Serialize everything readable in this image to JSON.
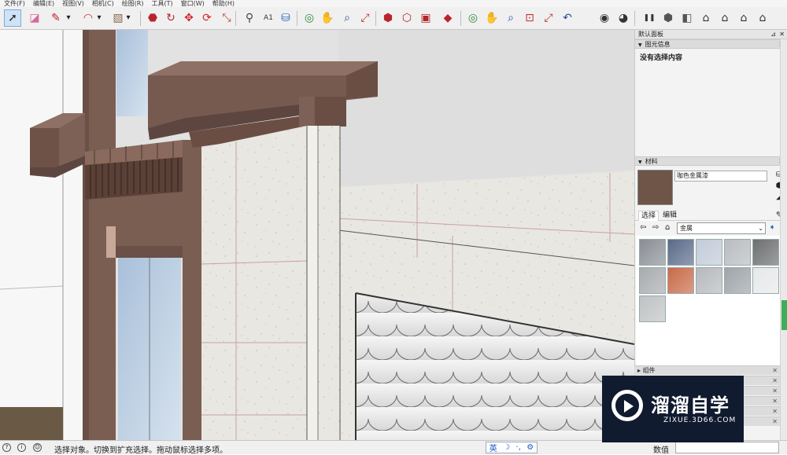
{
  "menu": [
    "文件(F)",
    "编辑(E)",
    "视图(V)",
    "相机(C)",
    "绘图(R)",
    "工具(T)",
    "窗口(W)",
    "帮助(H)"
  ],
  "toolbar": {
    "tools": [
      {
        "name": "select-tool",
        "glyph": "➚",
        "color": "#222222",
        "active": true
      },
      {
        "name": "eraser-tool",
        "glyph": "◪",
        "color": "#d86a9a"
      },
      {
        "name": "line-tool",
        "glyph": "✎",
        "color": "#b8242b"
      },
      {
        "name": "line-dropdown",
        "glyph": "▾",
        "color": "#222222"
      },
      {
        "name": "arc-tool",
        "glyph": "◠",
        "color": "#c0302b"
      },
      {
        "name": "arc-dropdown",
        "glyph": "▾",
        "color": "#222222"
      },
      {
        "name": "rectangle-tool",
        "glyph": "▧",
        "color": "#8a6a4a"
      },
      {
        "name": "rectangle-dropdown",
        "glyph": "▾",
        "color": "#222222"
      },
      {
        "name": "push-pull-tool",
        "glyph": "⬣",
        "color": "#b8242b"
      },
      {
        "name": "follow-me-tool",
        "glyph": "↻",
        "color": "#b8242b"
      },
      {
        "name": "move-tool",
        "glyph": "✥",
        "color": "#d2232a"
      },
      {
        "name": "rotate-tool",
        "glyph": "⟳",
        "color": "#d2232a"
      },
      {
        "name": "scale-tool",
        "glyph": "⤡",
        "color": "#c04020"
      },
      {
        "name": "tape-measure-tool",
        "glyph": "⚲",
        "color": "#444444"
      },
      {
        "name": "text-tool",
        "glyph": "A1",
        "color": "#333333"
      },
      {
        "name": "paint-bucket-tool",
        "glyph": "⛁",
        "color": "#2a6ab8"
      },
      {
        "name": "orbit-tool",
        "glyph": "◎",
        "color": "#2a8a3a"
      },
      {
        "name": "pan-tool",
        "glyph": "✋",
        "color": "#c8a060"
      },
      {
        "name": "zoom-tool",
        "glyph": "⌕",
        "color": "#2a4a9a"
      },
      {
        "name": "zoom-extents-tool",
        "glyph": "⤢",
        "color": "#c0302b"
      },
      {
        "name": "warehouse-tool",
        "glyph": "⬢",
        "color": "#b8242b"
      },
      {
        "name": "share-model-tool",
        "glyph": "⬡",
        "color": "#b8242b"
      },
      {
        "name": "send-to-layout-tool",
        "glyph": "▣",
        "color": "#b8242b"
      },
      {
        "name": "extension-warehouse-tool",
        "glyph": "◆",
        "color": "#b8242b"
      },
      {
        "name": "orbit-tool-2",
        "glyph": "◎",
        "color": "#2a8a3a"
      },
      {
        "name": "pan-tool-2",
        "glyph": "✋",
        "color": "#c8a060"
      },
      {
        "name": "zoom-tool-2",
        "glyph": "⌕",
        "color": "#2a4a9a"
      },
      {
        "name": "zoom-window-tool",
        "glyph": "⊡",
        "color": "#c0302b"
      },
      {
        "name": "zoom-extents-tool-2",
        "glyph": "⤢",
        "color": "#c0302b"
      },
      {
        "name": "previous-view-tool",
        "glyph": "↶",
        "color": "#2a4a9a"
      },
      {
        "name": "position-camera-tool",
        "glyph": "◉",
        "color": "#333333"
      },
      {
        "name": "look-around-tool",
        "glyph": "◕",
        "color": "#333333"
      },
      {
        "name": "walk-tool",
        "glyph": "❚❚",
        "color": "#333333"
      },
      {
        "name": "iso-view",
        "glyph": "⬢",
        "color": "#555555"
      },
      {
        "name": "top-view",
        "glyph": "◧",
        "color": "#555555"
      },
      {
        "name": "front-view",
        "glyph": "⌂",
        "color": "#333333"
      },
      {
        "name": "right-view",
        "glyph": "⌂",
        "color": "#333333"
      },
      {
        "name": "back-view",
        "glyph": "⌂",
        "color": "#333333"
      },
      {
        "name": "left-view",
        "glyph": "⌂",
        "color": "#333333"
      }
    ]
  },
  "tray": {
    "title": "默认面板",
    "entity_info": {
      "title": "图元信息",
      "content": "没有选择内容"
    },
    "materials": {
      "title": "材料",
      "current_name": "咖色金属漆",
      "current_color": "#6e5548",
      "tab_select": "选择",
      "tab_edit": "编辑",
      "library": "金属",
      "thumbnails": [
        {
          "name": "metal-pattern",
          "color": "#8a8e94"
        },
        {
          "name": "blue-steel",
          "color": "#5a6a88"
        },
        {
          "name": "light-blue-metal",
          "color": "#c2cbd8"
        },
        {
          "name": "silver-metal",
          "color": "#b8bcc0"
        },
        {
          "name": "dark-metal",
          "color": "#6c6e70"
        },
        {
          "name": "corrugated-metal",
          "color": "#a8abae"
        },
        {
          "name": "rusted-metal",
          "color": "#c86a48"
        },
        {
          "name": "diamond-plate",
          "color": "#b6b9bc"
        },
        {
          "name": "brushed-steel",
          "color": "#9ea4aa"
        },
        {
          "name": "polished-metal",
          "color": "#e6e8ea"
        },
        {
          "name": "aluminum",
          "color": "#bfc2c4"
        }
      ]
    },
    "components": {
      "title": "组件"
    }
  },
  "statusbar": {
    "message": "选择对象。切换到扩充选择。拖动鼠标选择多项。",
    "ime": [
      "英",
      "☽",
      "·,",
      "⚙"
    ],
    "vcb_label": "数值",
    "vcb_value": ""
  },
  "watermark": {
    "cn": "溜溜自学",
    "en": "ZIXUE.3D66.COM"
  }
}
